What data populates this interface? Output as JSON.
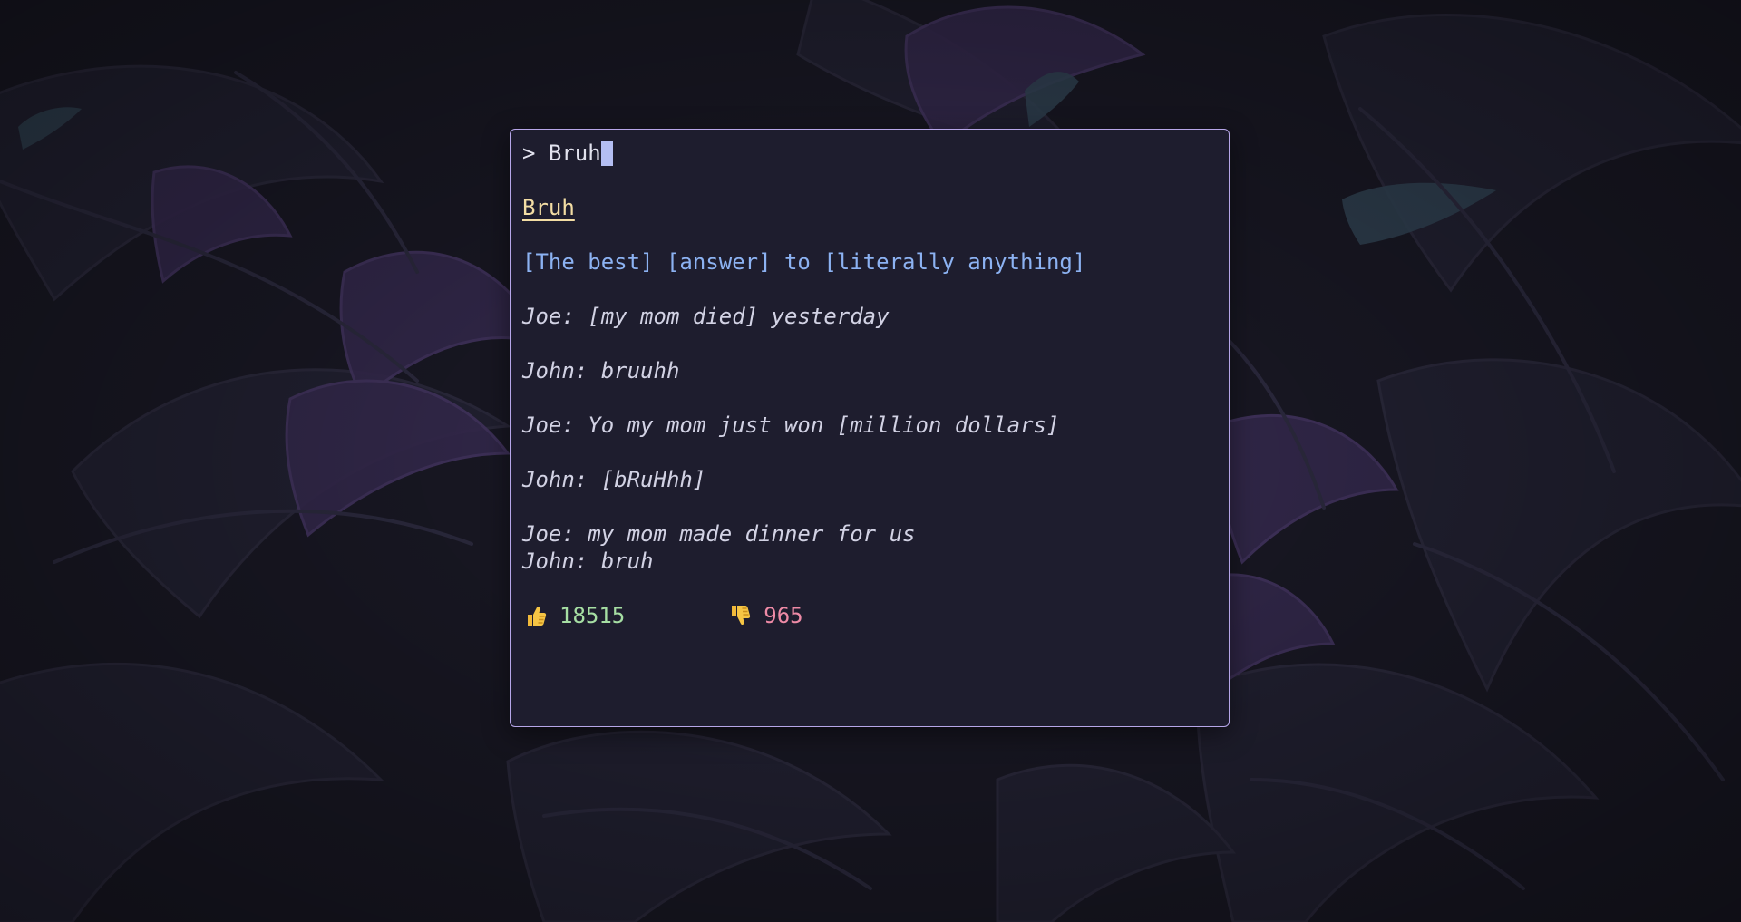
{
  "prompt": {
    "symbol": ">",
    "query": "Bruh"
  },
  "entry": {
    "word": "Bruh",
    "definition": "[The best] [answer] to [literally anything]",
    "example_lines": [
      "Joe: [my mom died] yesterday",
      "John: bruuhh",
      "Joe: Yo my mom just won [million dollars]",
      "John: [bRuHhh]",
      "Joe: my mom made dinner for us",
      "John: bruh"
    ],
    "thumbs_up": "18515",
    "thumbs_down": "965"
  },
  "colors": {
    "border": "#b6a6e8",
    "word": "#f3dda4",
    "definition": "#8cb2f2",
    "thumbs_up": "#a6dea3",
    "thumbs_down": "#ee8aa6"
  },
  "icons": [
    "thumbs-up-icon",
    "thumbs-down-icon"
  ]
}
